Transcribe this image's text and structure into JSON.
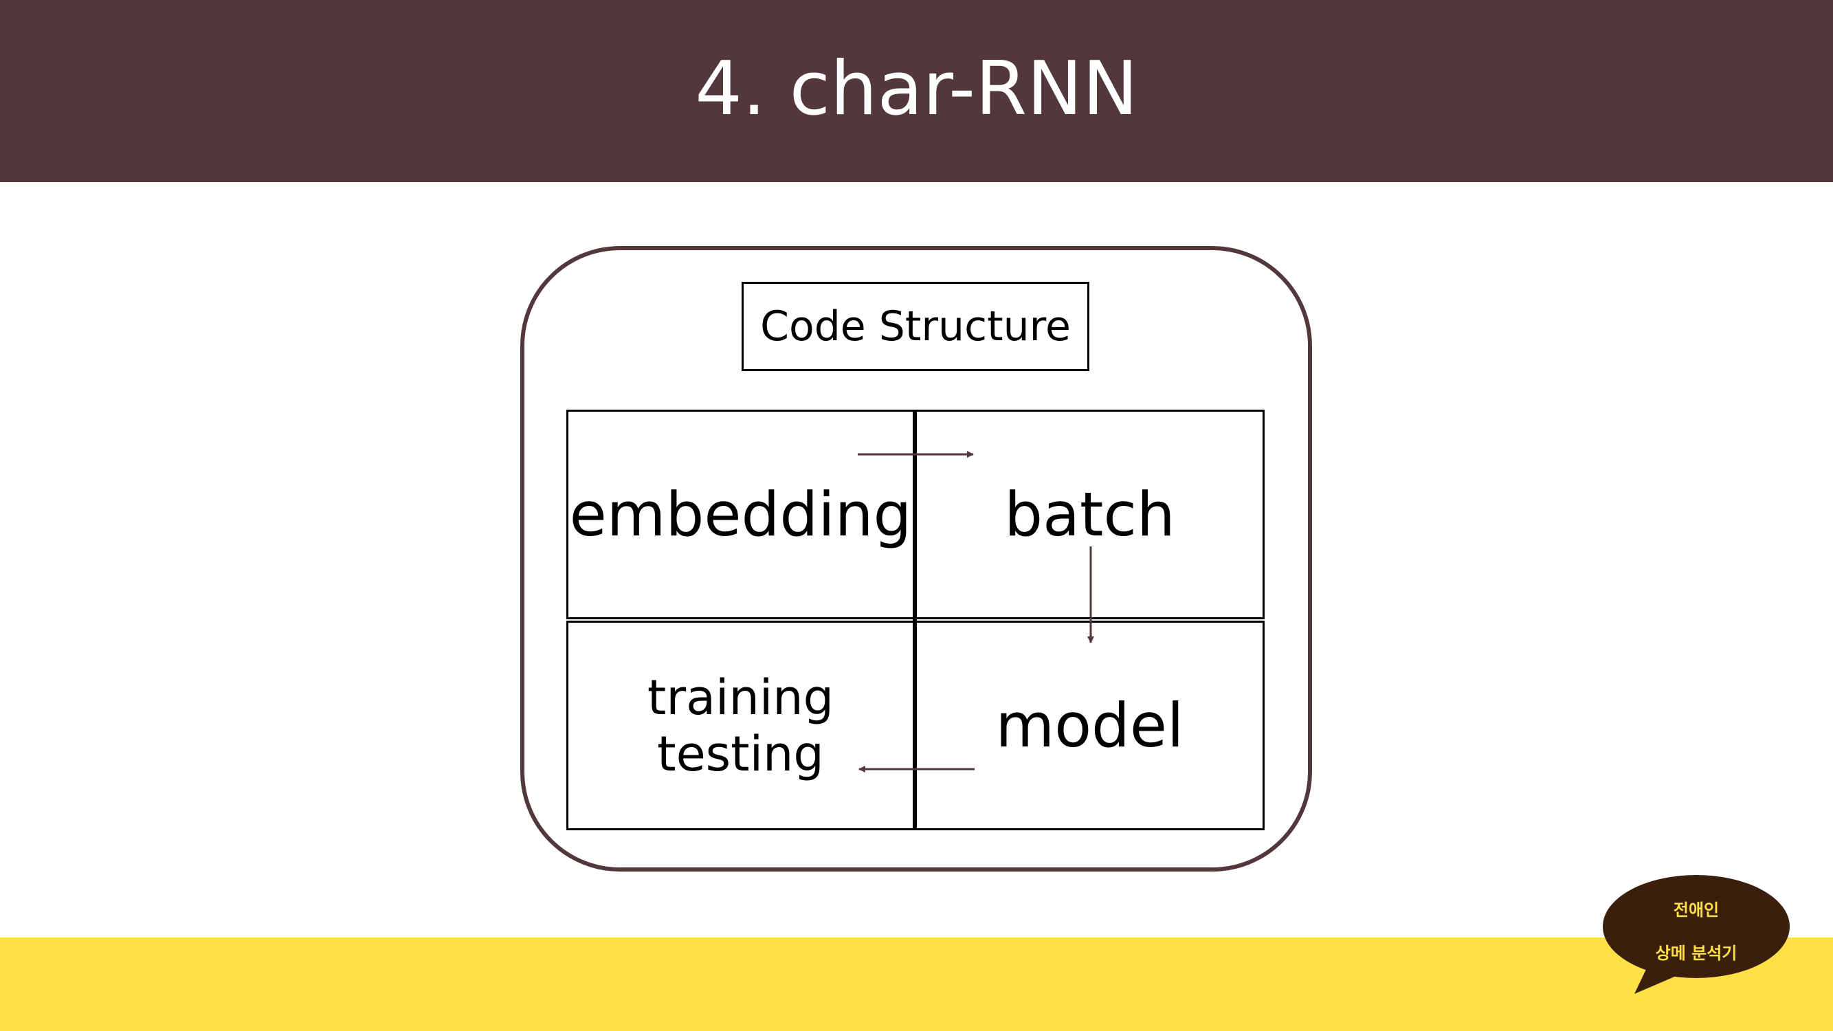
{
  "slide": {
    "title": "4. char-RNN"
  },
  "diagram": {
    "heading": "Code Structure",
    "cells": {
      "top_left": "embedding",
      "top_right": "batch",
      "bottom_left_line1": "training",
      "bottom_left_line2": "testing",
      "bottom_right": "model"
    }
  },
  "badge": {
    "line1": "전애인",
    "line2": "상메 분석기"
  },
  "colors": {
    "header": "#53383b",
    "footer": "#ffe047",
    "frame": "#53383b",
    "bubble": "#3a1f0c"
  }
}
